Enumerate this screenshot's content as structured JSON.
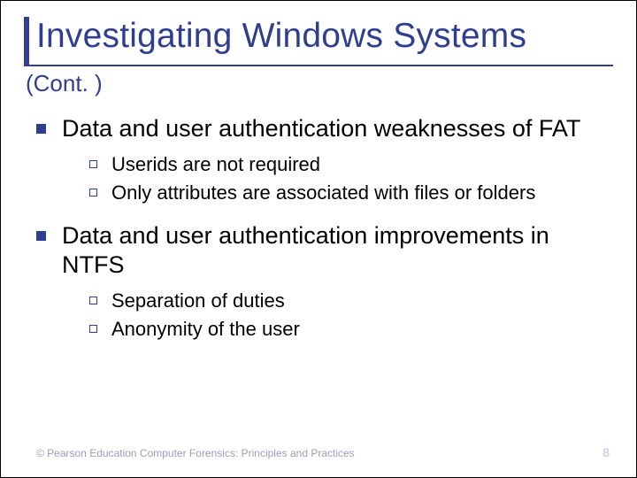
{
  "title": "Investigating Windows Systems",
  "subtitle": "(Cont. )",
  "bullets": [
    {
      "text": "Data and user authentication weaknesses of FAT",
      "sub": [
        "Userids are not required",
        "Only attributes are associated with files or folders"
      ]
    },
    {
      "text": "Data and user authentication improvements in NTFS",
      "sub": [
        "Separation of duties",
        "Anonymity of the user"
      ]
    }
  ],
  "footer": {
    "copyright": "© Pearson Education  Computer Forensics: Principles and Practices",
    "page": "8"
  }
}
